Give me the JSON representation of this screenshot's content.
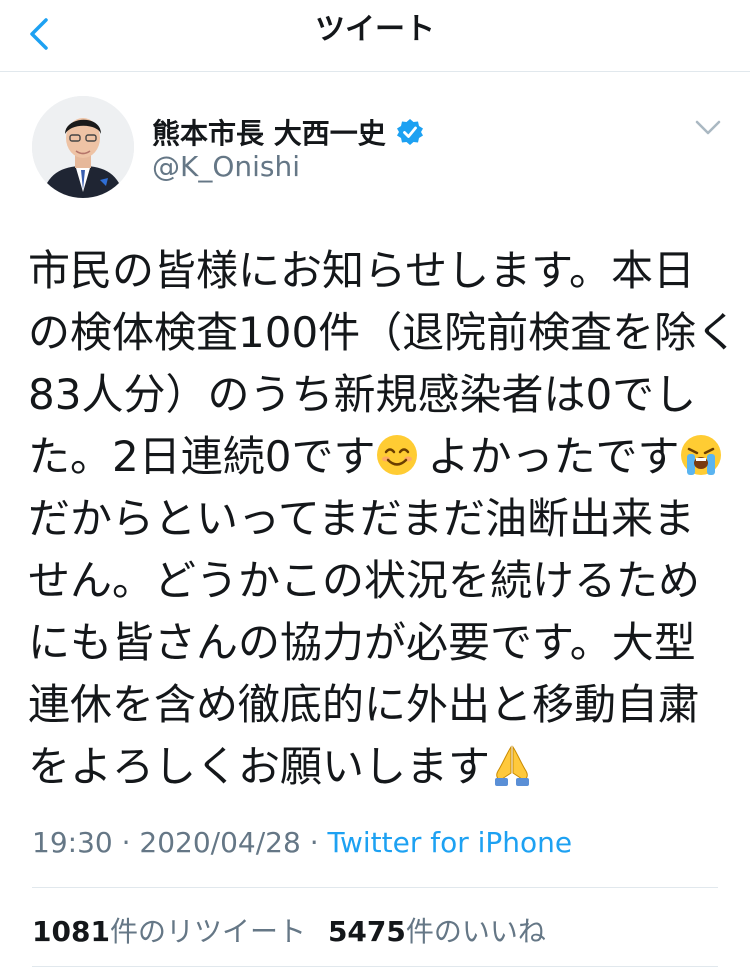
{
  "header": {
    "title": "ツイート"
  },
  "author": {
    "display_name": "熊本市長 大西一史",
    "handle": "@K_Onishi",
    "verified": true
  },
  "tweet": {
    "lines": [
      "市民の皆様にお知らせします。本日",
      "の検体検査100件（退院前検査を除く",
      "83人分）のうち新規感染者は0でし",
      "た。2日連続0です",
      "だからといってまだまだ油断出来ま",
      "せん。どうかこの状況を続けるため",
      "にも皆さんの協力が必要です。大型",
      "連休を含め徹底的に外出と移動自粛",
      "をよろしくお願いします"
    ],
    "line4_middle": "よかったです",
    "emojis": [
      "smiling-face-icon",
      "loudly-crying-face-icon",
      "folded-hands-icon"
    ]
  },
  "meta": {
    "time": "19:30",
    "sep": " · ",
    "date": "2020/04/28",
    "source": "Twitter for iPhone"
  },
  "stats": {
    "retweets": "1081",
    "retweets_label": "件のリツイート",
    "likes": "5475",
    "likes_label": "件のいいね"
  },
  "colors": {
    "accent": "#1da1f2",
    "text": "#14171a",
    "secondary": "#657786",
    "divider": "#e1e8ed"
  }
}
